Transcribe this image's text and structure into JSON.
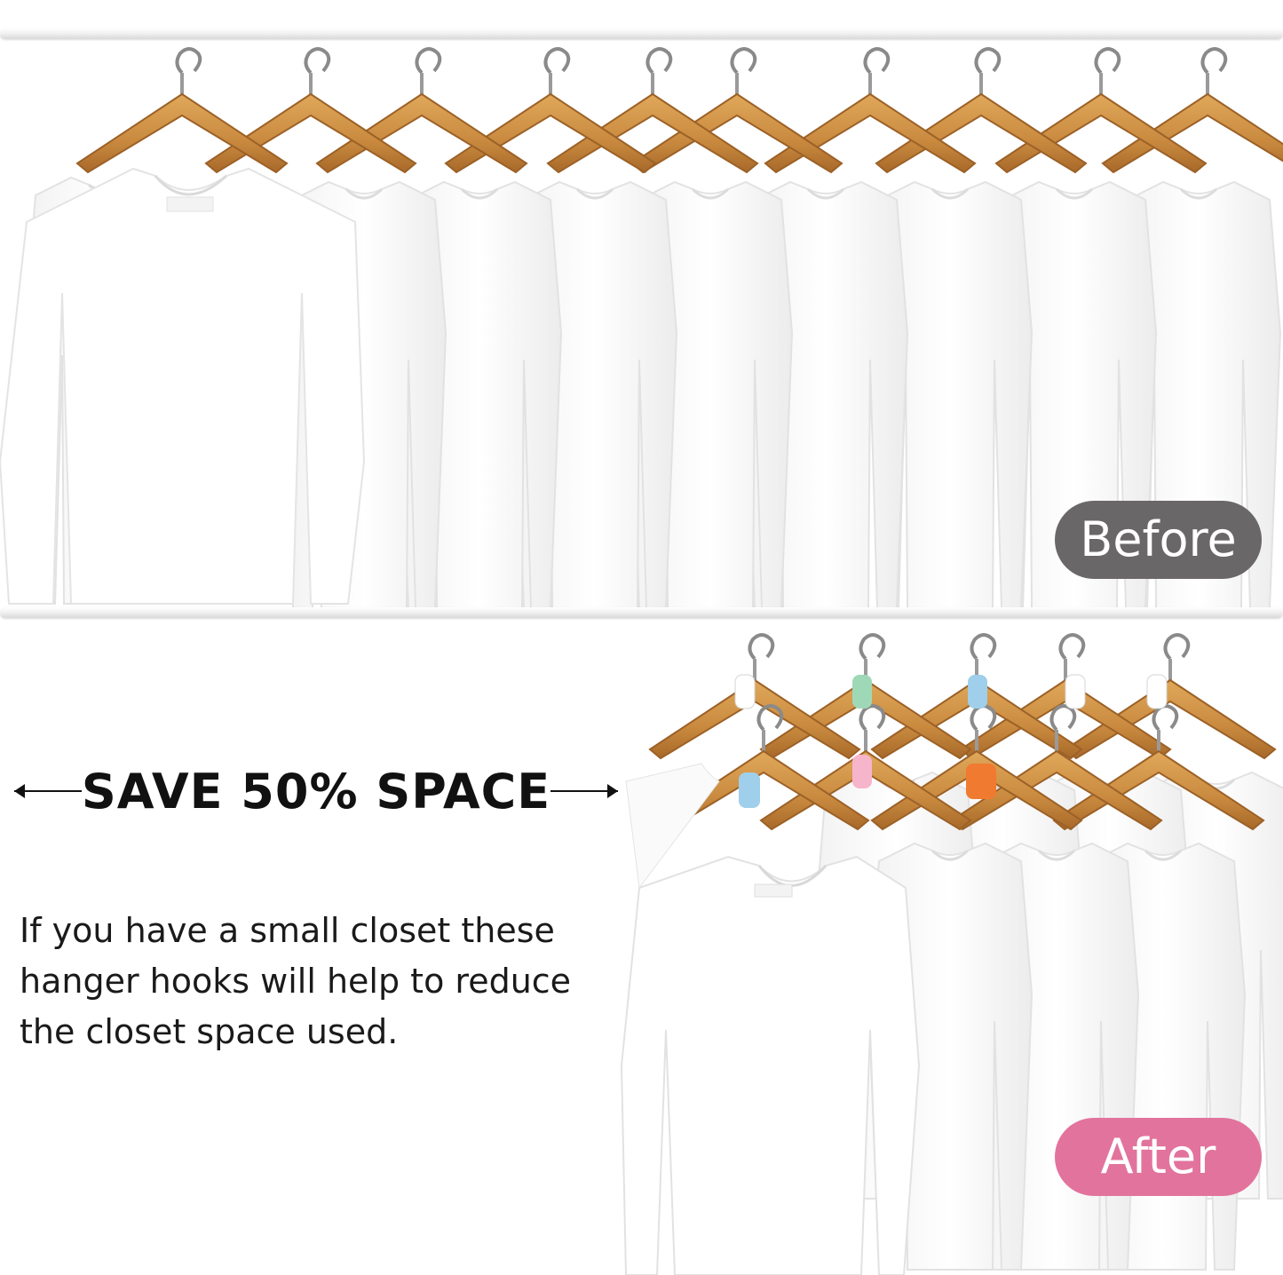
{
  "labels": {
    "before": "Before",
    "after": "After"
  },
  "headline": {
    "text": "SAVE 50% SPACE",
    "arrow_left_icon": "left-arrow-icon",
    "arrow_right_icon": "right-arrow-icon"
  },
  "description": {
    "text": "If you have a small closet these hanger hooks will help to reduce the closet space used."
  },
  "colors": {
    "before_badge": "#6a6768",
    "after_badge": "#e2739c",
    "wood_hanger": "#c98a3f",
    "shirt": "#ffffff",
    "hook_accents": [
      "#ffffff",
      "#9fd8b6",
      "#9fcfea",
      "#f7b5cc",
      "#f07a2f"
    ]
  }
}
